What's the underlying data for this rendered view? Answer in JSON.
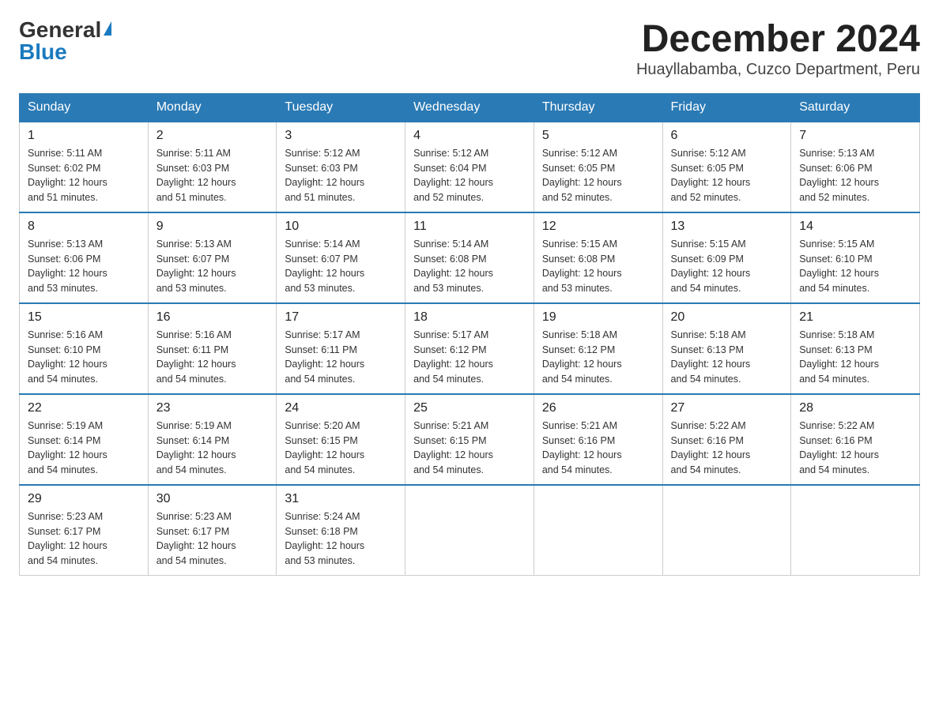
{
  "logo": {
    "general": "General",
    "blue": "Blue"
  },
  "title": "December 2024",
  "subtitle": "Huayllabamba, Cuzco Department, Peru",
  "days_of_week": [
    "Sunday",
    "Monday",
    "Tuesday",
    "Wednesday",
    "Thursday",
    "Friday",
    "Saturday"
  ],
  "weeks": [
    [
      {
        "day": "1",
        "sunrise": "5:11 AM",
        "sunset": "6:02 PM",
        "daylight": "12 hours and 51 minutes."
      },
      {
        "day": "2",
        "sunrise": "5:11 AM",
        "sunset": "6:03 PM",
        "daylight": "12 hours and 51 minutes."
      },
      {
        "day": "3",
        "sunrise": "5:12 AM",
        "sunset": "6:03 PM",
        "daylight": "12 hours and 51 minutes."
      },
      {
        "day": "4",
        "sunrise": "5:12 AM",
        "sunset": "6:04 PM",
        "daylight": "12 hours and 52 minutes."
      },
      {
        "day": "5",
        "sunrise": "5:12 AM",
        "sunset": "6:05 PM",
        "daylight": "12 hours and 52 minutes."
      },
      {
        "day": "6",
        "sunrise": "5:12 AM",
        "sunset": "6:05 PM",
        "daylight": "12 hours and 52 minutes."
      },
      {
        "day": "7",
        "sunrise": "5:13 AM",
        "sunset": "6:06 PM",
        "daylight": "12 hours and 52 minutes."
      }
    ],
    [
      {
        "day": "8",
        "sunrise": "5:13 AM",
        "sunset": "6:06 PM",
        "daylight": "12 hours and 53 minutes."
      },
      {
        "day": "9",
        "sunrise": "5:13 AM",
        "sunset": "6:07 PM",
        "daylight": "12 hours and 53 minutes."
      },
      {
        "day": "10",
        "sunrise": "5:14 AM",
        "sunset": "6:07 PM",
        "daylight": "12 hours and 53 minutes."
      },
      {
        "day": "11",
        "sunrise": "5:14 AM",
        "sunset": "6:08 PM",
        "daylight": "12 hours and 53 minutes."
      },
      {
        "day": "12",
        "sunrise": "5:15 AM",
        "sunset": "6:08 PM",
        "daylight": "12 hours and 53 minutes."
      },
      {
        "day": "13",
        "sunrise": "5:15 AM",
        "sunset": "6:09 PM",
        "daylight": "12 hours and 54 minutes."
      },
      {
        "day": "14",
        "sunrise": "5:15 AM",
        "sunset": "6:10 PM",
        "daylight": "12 hours and 54 minutes."
      }
    ],
    [
      {
        "day": "15",
        "sunrise": "5:16 AM",
        "sunset": "6:10 PM",
        "daylight": "12 hours and 54 minutes."
      },
      {
        "day": "16",
        "sunrise": "5:16 AM",
        "sunset": "6:11 PM",
        "daylight": "12 hours and 54 minutes."
      },
      {
        "day": "17",
        "sunrise": "5:17 AM",
        "sunset": "6:11 PM",
        "daylight": "12 hours and 54 minutes."
      },
      {
        "day": "18",
        "sunrise": "5:17 AM",
        "sunset": "6:12 PM",
        "daylight": "12 hours and 54 minutes."
      },
      {
        "day": "19",
        "sunrise": "5:18 AM",
        "sunset": "6:12 PM",
        "daylight": "12 hours and 54 minutes."
      },
      {
        "day": "20",
        "sunrise": "5:18 AM",
        "sunset": "6:13 PM",
        "daylight": "12 hours and 54 minutes."
      },
      {
        "day": "21",
        "sunrise": "5:18 AM",
        "sunset": "6:13 PM",
        "daylight": "12 hours and 54 minutes."
      }
    ],
    [
      {
        "day": "22",
        "sunrise": "5:19 AM",
        "sunset": "6:14 PM",
        "daylight": "12 hours and 54 minutes."
      },
      {
        "day": "23",
        "sunrise": "5:19 AM",
        "sunset": "6:14 PM",
        "daylight": "12 hours and 54 minutes."
      },
      {
        "day": "24",
        "sunrise": "5:20 AM",
        "sunset": "6:15 PM",
        "daylight": "12 hours and 54 minutes."
      },
      {
        "day": "25",
        "sunrise": "5:21 AM",
        "sunset": "6:15 PM",
        "daylight": "12 hours and 54 minutes."
      },
      {
        "day": "26",
        "sunrise": "5:21 AM",
        "sunset": "6:16 PM",
        "daylight": "12 hours and 54 minutes."
      },
      {
        "day": "27",
        "sunrise": "5:22 AM",
        "sunset": "6:16 PM",
        "daylight": "12 hours and 54 minutes."
      },
      {
        "day": "28",
        "sunrise": "5:22 AM",
        "sunset": "6:16 PM",
        "daylight": "12 hours and 54 minutes."
      }
    ],
    [
      {
        "day": "29",
        "sunrise": "5:23 AM",
        "sunset": "6:17 PM",
        "daylight": "12 hours and 54 minutes."
      },
      {
        "day": "30",
        "sunrise": "5:23 AM",
        "sunset": "6:17 PM",
        "daylight": "12 hours and 54 minutes."
      },
      {
        "day": "31",
        "sunrise": "5:24 AM",
        "sunset": "6:18 PM",
        "daylight": "12 hours and 53 minutes."
      },
      null,
      null,
      null,
      null
    ]
  ],
  "labels": {
    "sunrise": "Sunrise:",
    "sunset": "Sunset:",
    "daylight": "Daylight:"
  }
}
